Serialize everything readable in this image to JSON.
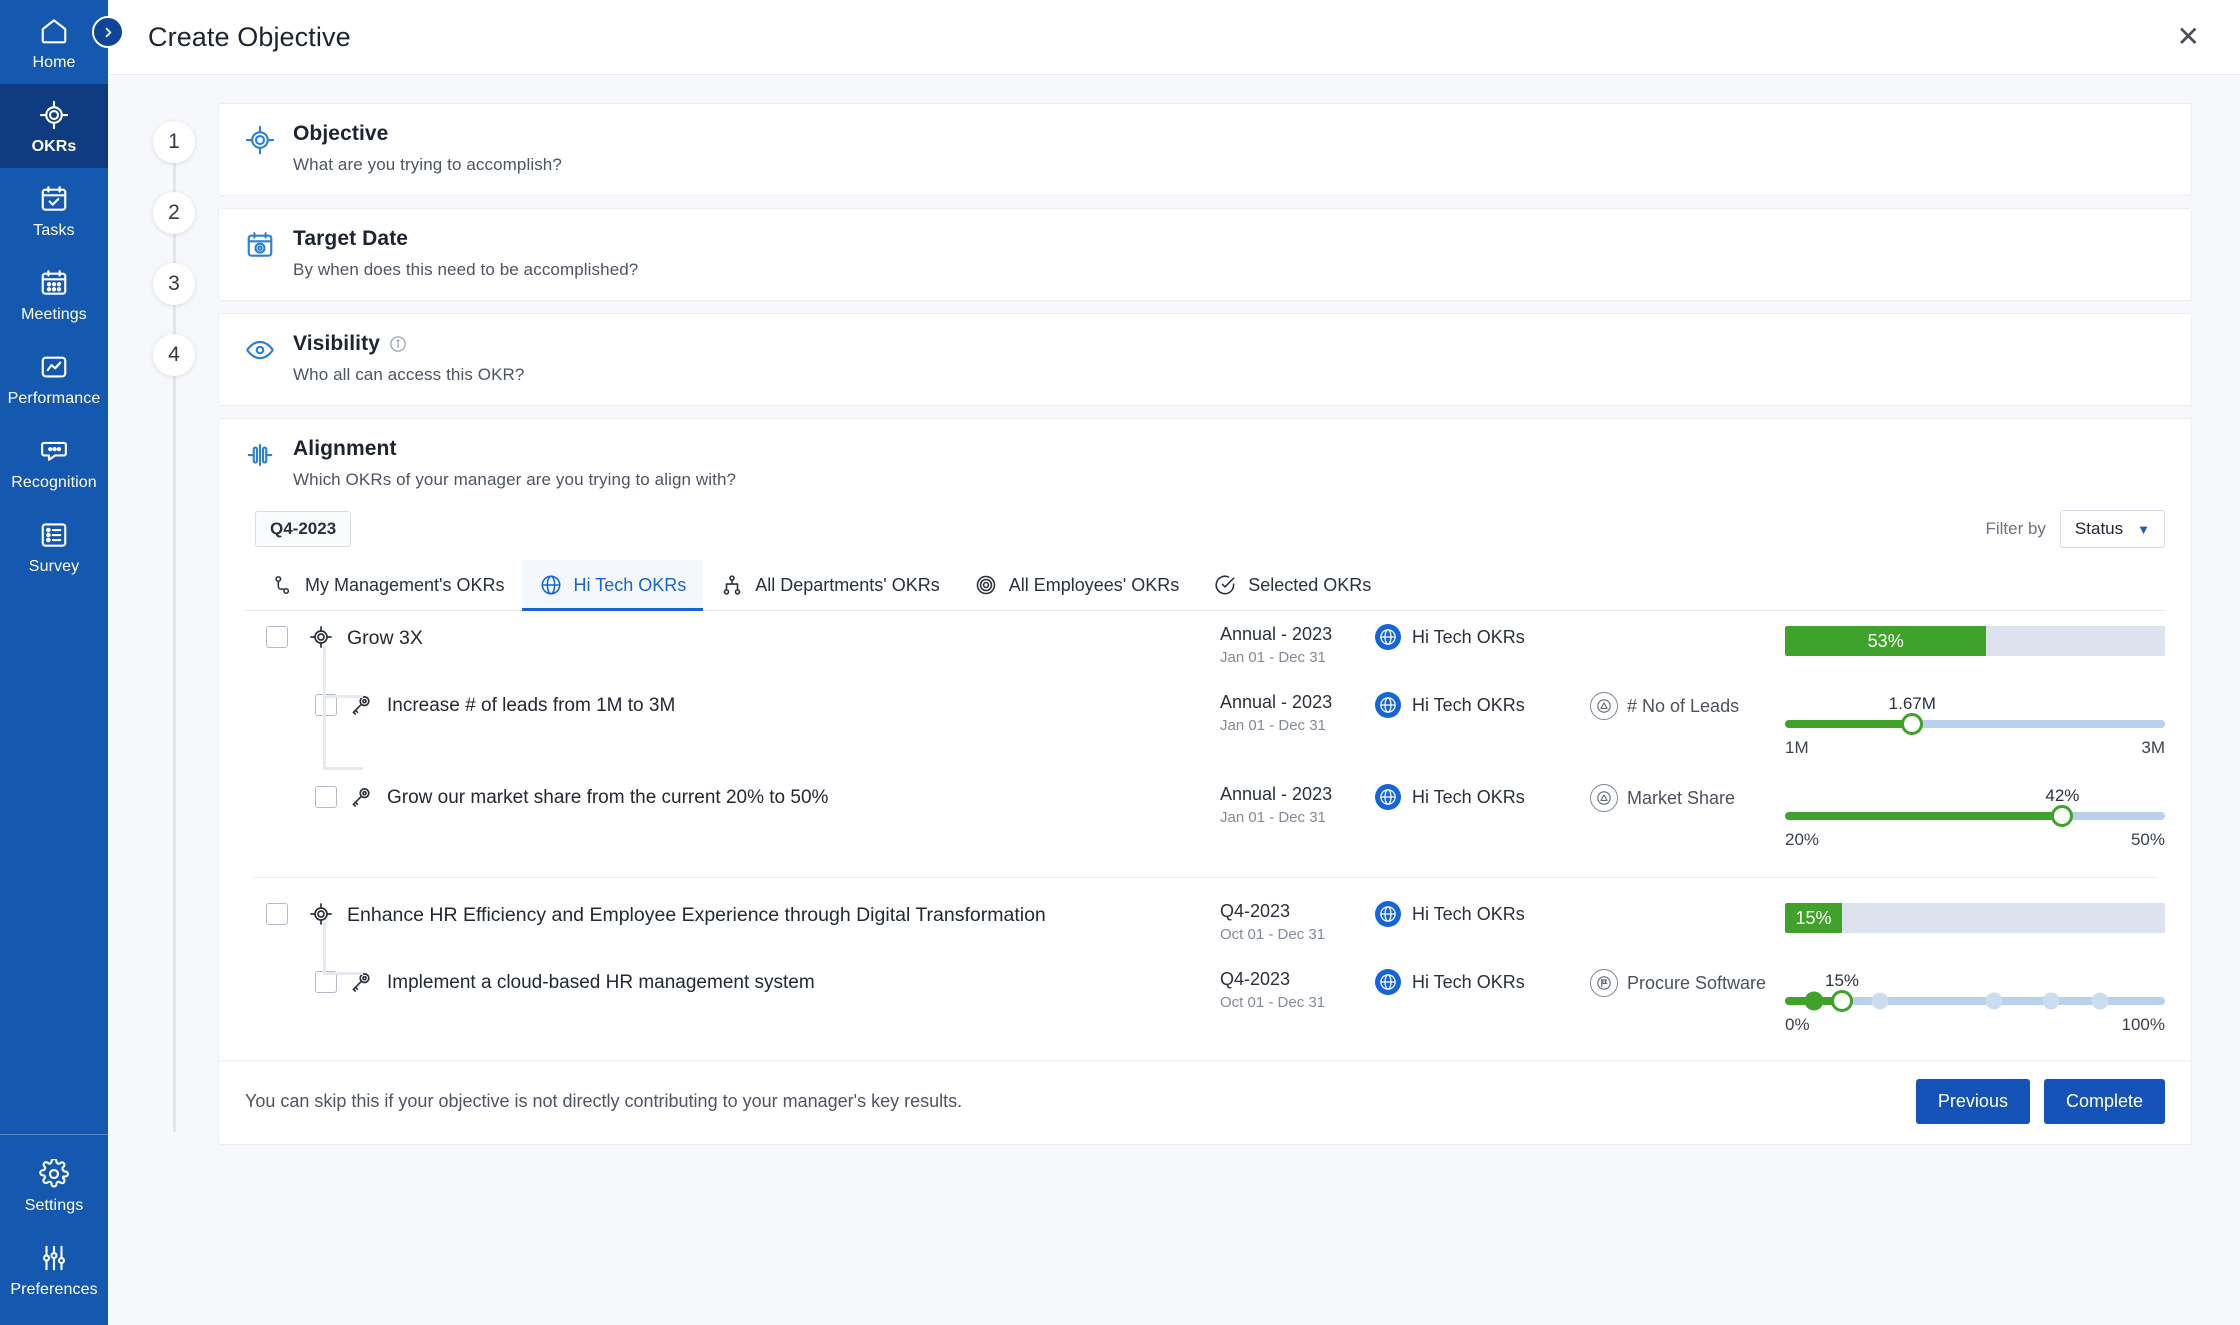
{
  "sidebar": {
    "top_items": [
      {
        "label": "Home",
        "icon": "home-icon",
        "active": false
      },
      {
        "label": "OKRs",
        "icon": "target-icon",
        "active": true
      },
      {
        "label": "Tasks",
        "icon": "calendar-check-icon",
        "active": false
      },
      {
        "label": "Meetings",
        "icon": "calendar-icon",
        "active": false
      },
      {
        "label": "Performance",
        "icon": "chart-icon",
        "active": false
      },
      {
        "label": "Recognition",
        "icon": "speech-bubble-icon",
        "active": false
      },
      {
        "label": "Survey",
        "icon": "list-icon",
        "active": false
      }
    ],
    "bottom_items": [
      {
        "label": "Settings",
        "icon": "gear-icon"
      },
      {
        "label": "Preferences",
        "icon": "sliders-icon"
      }
    ],
    "collapse_icon": "chevron-right-icon"
  },
  "header": {
    "title": "Create Objective",
    "close_icon": "close-icon"
  },
  "steps": [
    {
      "num": "1",
      "title": "Objective",
      "subtitle": "What are you trying to accomplish?",
      "icon": "target-icon",
      "info": false
    },
    {
      "num": "2",
      "title": "Target Date",
      "subtitle": "By when does this need to be accomplished?",
      "icon": "calendar-target-icon",
      "info": false
    },
    {
      "num": "3",
      "title": "Visibility",
      "subtitle": "Who all can access this OKR?",
      "icon": "eye-icon",
      "info": true
    },
    {
      "num": "4",
      "title": "Alignment",
      "subtitle": "Which OKRs of your manager are you trying to align with?",
      "icon": "alignment-icon",
      "info": false
    }
  ],
  "alignment": {
    "quarter_chip": "Q4-2023",
    "filter_label": "Filter by",
    "filter_value": "Status",
    "filter_chevron": "chevron-down-icon",
    "tabs": [
      {
        "label": "My Management's OKRs",
        "icon": "org-node-icon",
        "active": false
      },
      {
        "label": "Hi Tech OKRs",
        "icon": "globe-icon",
        "active": true
      },
      {
        "label": "All Departments' OKRs",
        "icon": "hierarchy-icon",
        "active": false
      },
      {
        "label": "All Employees' OKRs",
        "icon": "concentric-circles-icon",
        "active": false
      },
      {
        "label": "Selected OKRs",
        "icon": "check-circle-icon",
        "active": false
      }
    ],
    "groups": [
      {
        "objective": {
          "name": "Grow 3X",
          "icon": "objective-target-icon",
          "period": "Annual - 2023",
          "dates": "Jan 01 - Dec 31",
          "owner": "Hi Tech OKRs",
          "owner_icon": "globe-icon",
          "metric": null,
          "progress_type": "bar",
          "progress_pct": 53,
          "progress_label": "53%",
          "checked": false
        },
        "key_results": [
          {
            "name": "Increase # of leads from 1M to 3M",
            "icon": "key-icon",
            "period": "Annual - 2023",
            "dates": "Jan 01 - Dec 31",
            "owner": "Hi Tech OKRs",
            "owner_icon": "globe-icon",
            "metric": "# No of Leads",
            "metric_icon": "triangle-circle-icon",
            "progress_type": "slider",
            "value_label": "1.67M",
            "start_label": "1M",
            "end_label": "3M",
            "fill_pct": 33.5,
            "checked": false
          },
          {
            "name": "Grow our market share from the current 20% to 50%",
            "icon": "key-icon",
            "period": "Annual - 2023",
            "dates": "Jan 01 - Dec 31",
            "owner": "Hi Tech OKRs",
            "owner_icon": "globe-icon",
            "metric": "Market Share",
            "metric_icon": "triangle-circle-icon",
            "progress_type": "slider",
            "value_label": "42%",
            "start_label": "20%",
            "end_label": "50%",
            "fill_pct": 73,
            "checked": false
          }
        ]
      },
      {
        "objective": {
          "name": "Enhance HR Efficiency and Employee Experience through Digital Transformation",
          "icon": "objective-target-icon",
          "period": "Q4-2023",
          "dates": "Oct 01 - Dec 31",
          "owner": "Hi Tech OKRs",
          "owner_icon": "globe-icon",
          "metric": null,
          "progress_type": "bar",
          "progress_pct": 15,
          "progress_label": "15%",
          "checked": false
        },
        "key_results": [
          {
            "name": "Implement a cloud-based HR management system",
            "icon": "key-icon",
            "period": "Q4-2023",
            "dates": "Oct 01 - Dec 31",
            "owner": "Hi Tech OKRs",
            "owner_icon": "globe-icon",
            "metric": "Procure Software",
            "metric_icon": "milestone-flag-icon",
            "progress_type": "milestone",
            "value_label": "15%",
            "start_label": "0%",
            "end_label": "100%",
            "fill_pct": 15,
            "milestones": [
              7.5,
              25,
              55,
              70,
              83
            ],
            "checked": false
          }
        ]
      }
    ],
    "footer_note": "You can skip this if your objective is not directly contributing to your manager's key results.",
    "previous_label": "Previous",
    "complete_label": "Complete"
  },
  "colors": {
    "sidebar_blue": "#1558B0",
    "sidebar_active": "#0F3C80",
    "accent_blue": "#1553B8",
    "progress_green": "#3FA22B",
    "track_grey": "#DDE2EF",
    "slider_track": "#B9D1EA"
  }
}
